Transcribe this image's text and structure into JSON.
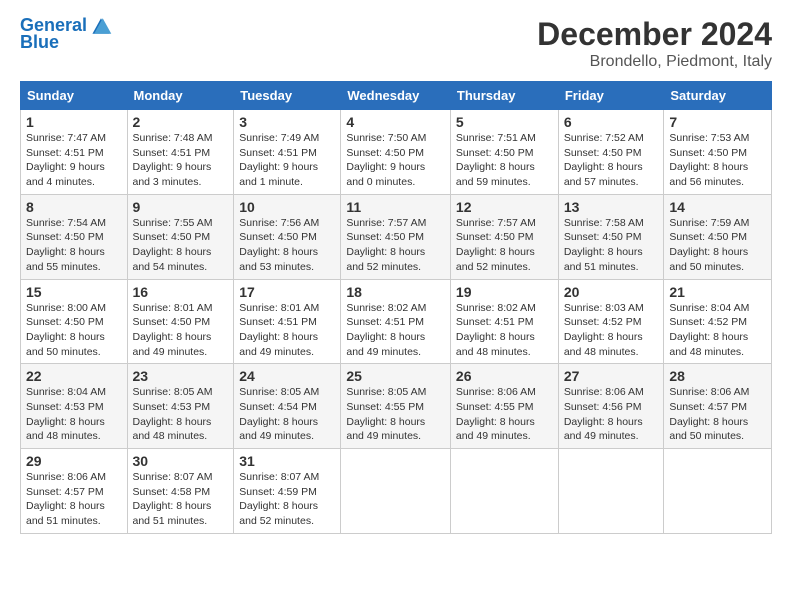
{
  "header": {
    "logo_line1": "General",
    "logo_line2": "Blue",
    "title": "December 2024",
    "subtitle": "Brondello, Piedmont, Italy"
  },
  "weekdays": [
    "Sunday",
    "Monday",
    "Tuesday",
    "Wednesday",
    "Thursday",
    "Friday",
    "Saturday"
  ],
  "weeks": [
    [
      {
        "day": "1",
        "sunrise": "7:47 AM",
        "sunset": "4:51 PM",
        "daylight": "9 hours and 4 minutes."
      },
      {
        "day": "2",
        "sunrise": "7:48 AM",
        "sunset": "4:51 PM",
        "daylight": "9 hours and 3 minutes."
      },
      {
        "day": "3",
        "sunrise": "7:49 AM",
        "sunset": "4:51 PM",
        "daylight": "9 hours and 1 minute."
      },
      {
        "day": "4",
        "sunrise": "7:50 AM",
        "sunset": "4:50 PM",
        "daylight": "9 hours and 0 minutes."
      },
      {
        "day": "5",
        "sunrise": "7:51 AM",
        "sunset": "4:50 PM",
        "daylight": "8 hours and 59 minutes."
      },
      {
        "day": "6",
        "sunrise": "7:52 AM",
        "sunset": "4:50 PM",
        "daylight": "8 hours and 57 minutes."
      },
      {
        "day": "7",
        "sunrise": "7:53 AM",
        "sunset": "4:50 PM",
        "daylight": "8 hours and 56 minutes."
      }
    ],
    [
      {
        "day": "8",
        "sunrise": "7:54 AM",
        "sunset": "4:50 PM",
        "daylight": "8 hours and 55 minutes."
      },
      {
        "day": "9",
        "sunrise": "7:55 AM",
        "sunset": "4:50 PM",
        "daylight": "8 hours and 54 minutes."
      },
      {
        "day": "10",
        "sunrise": "7:56 AM",
        "sunset": "4:50 PM",
        "daylight": "8 hours and 53 minutes."
      },
      {
        "day": "11",
        "sunrise": "7:57 AM",
        "sunset": "4:50 PM",
        "daylight": "8 hours and 52 minutes."
      },
      {
        "day": "12",
        "sunrise": "7:57 AM",
        "sunset": "4:50 PM",
        "daylight": "8 hours and 52 minutes."
      },
      {
        "day": "13",
        "sunrise": "7:58 AM",
        "sunset": "4:50 PM",
        "daylight": "8 hours and 51 minutes."
      },
      {
        "day": "14",
        "sunrise": "7:59 AM",
        "sunset": "4:50 PM",
        "daylight": "8 hours and 50 minutes."
      }
    ],
    [
      {
        "day": "15",
        "sunrise": "8:00 AM",
        "sunset": "4:50 PM",
        "daylight": "8 hours and 50 minutes."
      },
      {
        "day": "16",
        "sunrise": "8:01 AM",
        "sunset": "4:50 PM",
        "daylight": "8 hours and 49 minutes."
      },
      {
        "day": "17",
        "sunrise": "8:01 AM",
        "sunset": "4:51 PM",
        "daylight": "8 hours and 49 minutes."
      },
      {
        "day": "18",
        "sunrise": "8:02 AM",
        "sunset": "4:51 PM",
        "daylight": "8 hours and 49 minutes."
      },
      {
        "day": "19",
        "sunrise": "8:02 AM",
        "sunset": "4:51 PM",
        "daylight": "8 hours and 48 minutes."
      },
      {
        "day": "20",
        "sunrise": "8:03 AM",
        "sunset": "4:52 PM",
        "daylight": "8 hours and 48 minutes."
      },
      {
        "day": "21",
        "sunrise": "8:04 AM",
        "sunset": "4:52 PM",
        "daylight": "8 hours and 48 minutes."
      }
    ],
    [
      {
        "day": "22",
        "sunrise": "8:04 AM",
        "sunset": "4:53 PM",
        "daylight": "8 hours and 48 minutes."
      },
      {
        "day": "23",
        "sunrise": "8:05 AM",
        "sunset": "4:53 PM",
        "daylight": "8 hours and 48 minutes."
      },
      {
        "day": "24",
        "sunrise": "8:05 AM",
        "sunset": "4:54 PM",
        "daylight": "8 hours and 49 minutes."
      },
      {
        "day": "25",
        "sunrise": "8:05 AM",
        "sunset": "4:55 PM",
        "daylight": "8 hours and 49 minutes."
      },
      {
        "day": "26",
        "sunrise": "8:06 AM",
        "sunset": "4:55 PM",
        "daylight": "8 hours and 49 minutes."
      },
      {
        "day": "27",
        "sunrise": "8:06 AM",
        "sunset": "4:56 PM",
        "daylight": "8 hours and 49 minutes."
      },
      {
        "day": "28",
        "sunrise": "8:06 AM",
        "sunset": "4:57 PM",
        "daylight": "8 hours and 50 minutes."
      }
    ],
    [
      {
        "day": "29",
        "sunrise": "8:06 AM",
        "sunset": "4:57 PM",
        "daylight": "8 hours and 51 minutes."
      },
      {
        "day": "30",
        "sunrise": "8:07 AM",
        "sunset": "4:58 PM",
        "daylight": "8 hours and 51 minutes."
      },
      {
        "day": "31",
        "sunrise": "8:07 AM",
        "sunset": "4:59 PM",
        "daylight": "8 hours and 52 minutes."
      },
      null,
      null,
      null,
      null
    ]
  ]
}
